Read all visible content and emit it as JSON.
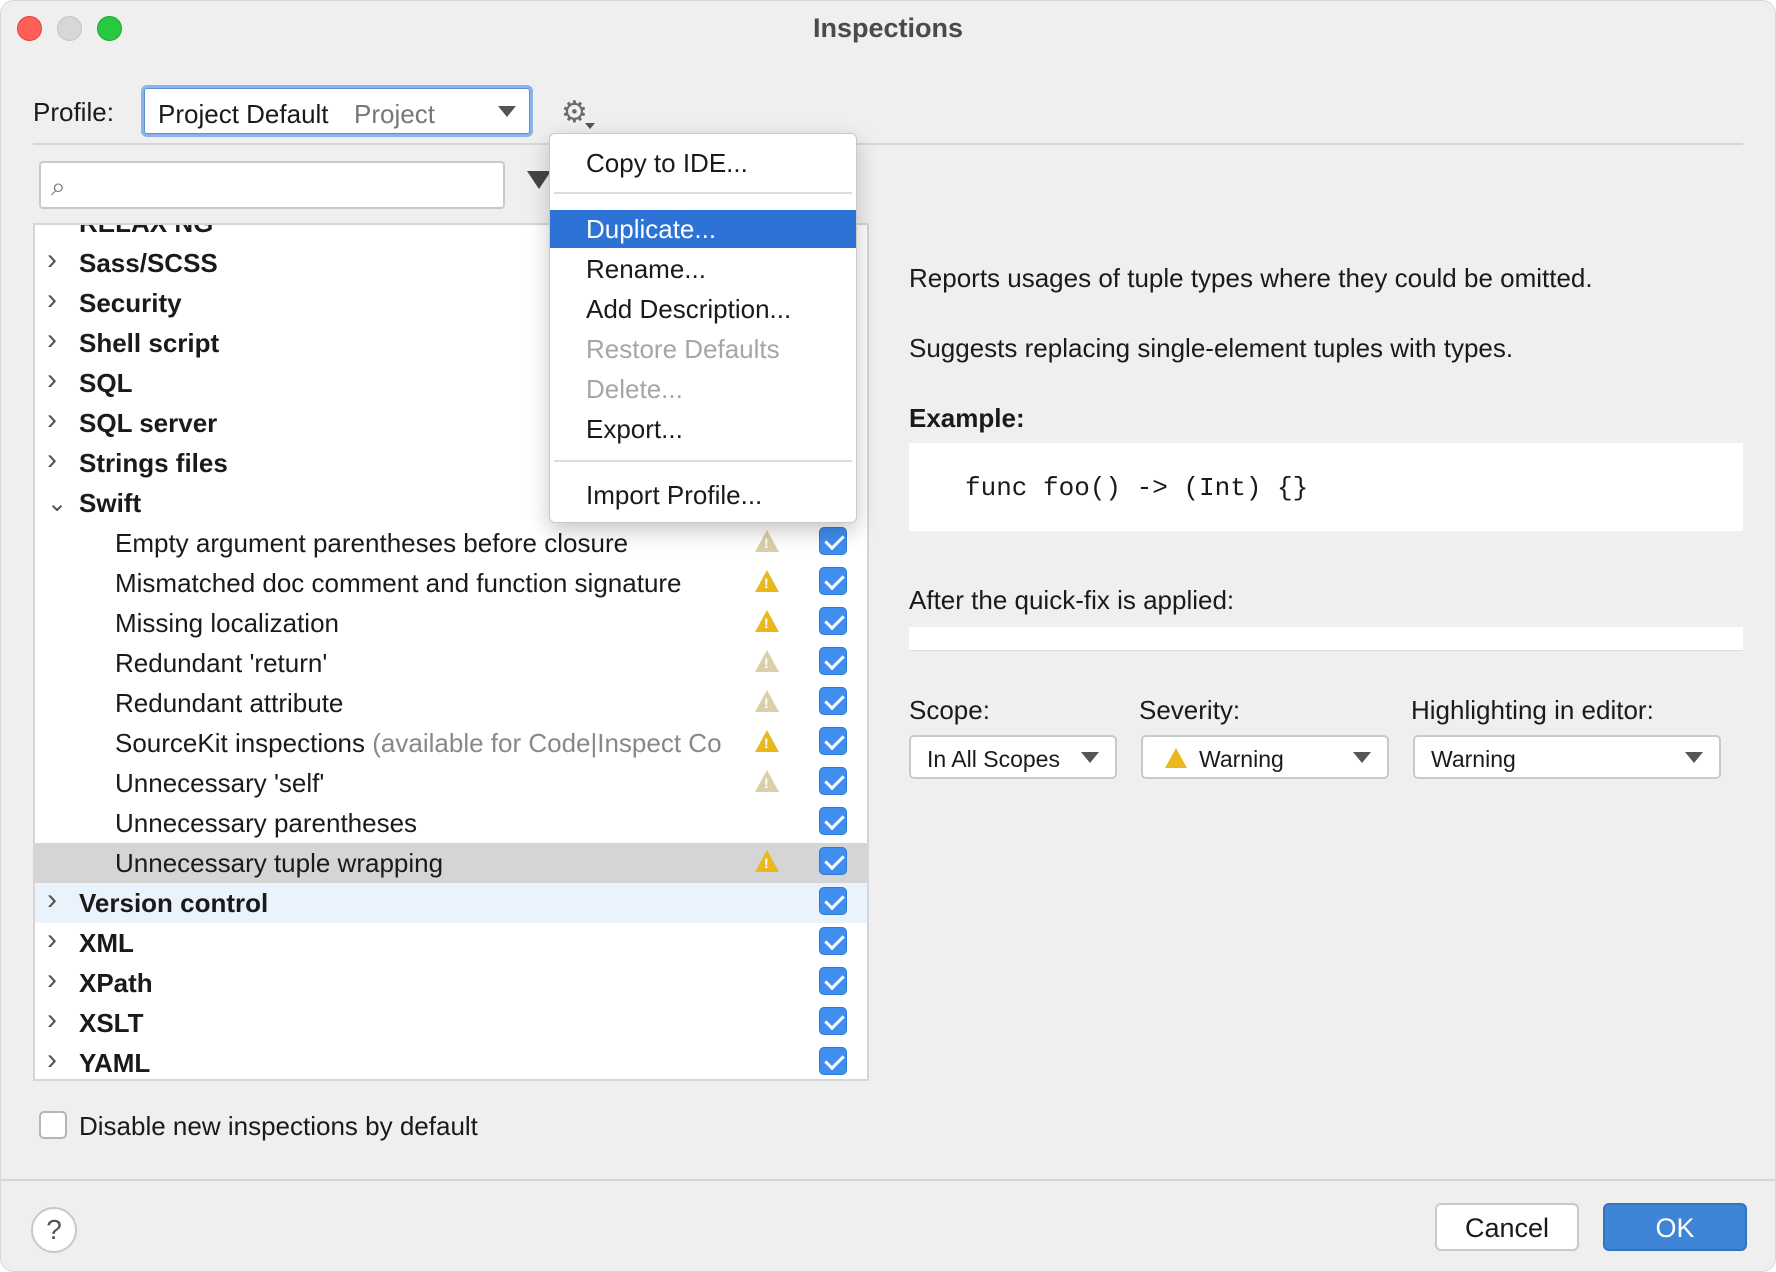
{
  "window": {
    "title": "Inspections"
  },
  "profile": {
    "label": "Profile:",
    "name": "Project Default",
    "type": "Project"
  },
  "search": {
    "placeholder": "",
    "value": ""
  },
  "tree": {
    "partial_top": "RELAX NG",
    "categories_before": [
      "Sass/SCSS",
      "Security",
      "Shell script",
      "SQL",
      "SQL server",
      "Strings files"
    ],
    "expanded_category": "Swift",
    "swift_items": [
      {
        "label": "Empty argument parentheses before closure",
        "note": "",
        "severity": "weak",
        "checked": true
      },
      {
        "label": "Mismatched doc comment and function signature",
        "note": "",
        "severity": "warning",
        "checked": true
      },
      {
        "label": "Missing localization",
        "note": "",
        "severity": "warning",
        "checked": true
      },
      {
        "label": "Redundant 'return'",
        "note": "",
        "severity": "weak",
        "checked": true
      },
      {
        "label": "Redundant attribute",
        "note": "",
        "severity": "weak",
        "checked": true
      },
      {
        "label": "SourceKit inspections",
        "note": "(available for Code|Inspect Co",
        "severity": "warning",
        "checked": true
      },
      {
        "label": "Unnecessary 'self'",
        "note": "",
        "severity": "weak",
        "checked": true
      },
      {
        "label": "Unnecessary parentheses",
        "note": "",
        "severity": "none",
        "checked": true
      },
      {
        "label": "Unnecessary tuple wrapping",
        "note": "",
        "severity": "warning",
        "checked": true,
        "selected": true
      }
    ],
    "categories_after": [
      "Version control",
      "XML",
      "XPath",
      "XSLT",
      "YAML"
    ]
  },
  "menu": {
    "items": [
      {
        "label": "Copy to IDE...",
        "state": "normal"
      },
      {
        "label": "Duplicate...",
        "state": "active"
      },
      {
        "label": "Rename...",
        "state": "normal"
      },
      {
        "label": "Add Description...",
        "state": "normal"
      },
      {
        "label": "Restore Defaults",
        "state": "disabled"
      },
      {
        "label": "Delete...",
        "state": "disabled"
      },
      {
        "label": "Export...",
        "state": "normal"
      },
      {
        "label": "Import Profile...",
        "state": "normal"
      }
    ]
  },
  "description": {
    "line1": "Reports usages of tuple types where they could be omitted.",
    "line2": "Suggests replacing single-element tuples with types.",
    "example_label": "Example:",
    "code": "func foo() -> (Int) {}",
    "after_label": "After the quick-fix is applied:"
  },
  "options": {
    "scope_label": "Scope:",
    "scope_value": "In All Scopes",
    "severity_label": "Severity:",
    "severity_value": "Warning",
    "highlight_label": "Highlighting in editor:",
    "highlight_value": "Warning"
  },
  "footer": {
    "disable_label": "Disable new inspections by default",
    "help": "?",
    "cancel": "Cancel",
    "ok": "OK"
  },
  "colors": {
    "accent": "#2c73d5",
    "warning": "#e9b81e",
    "checkbox": "#3f8ef0"
  }
}
